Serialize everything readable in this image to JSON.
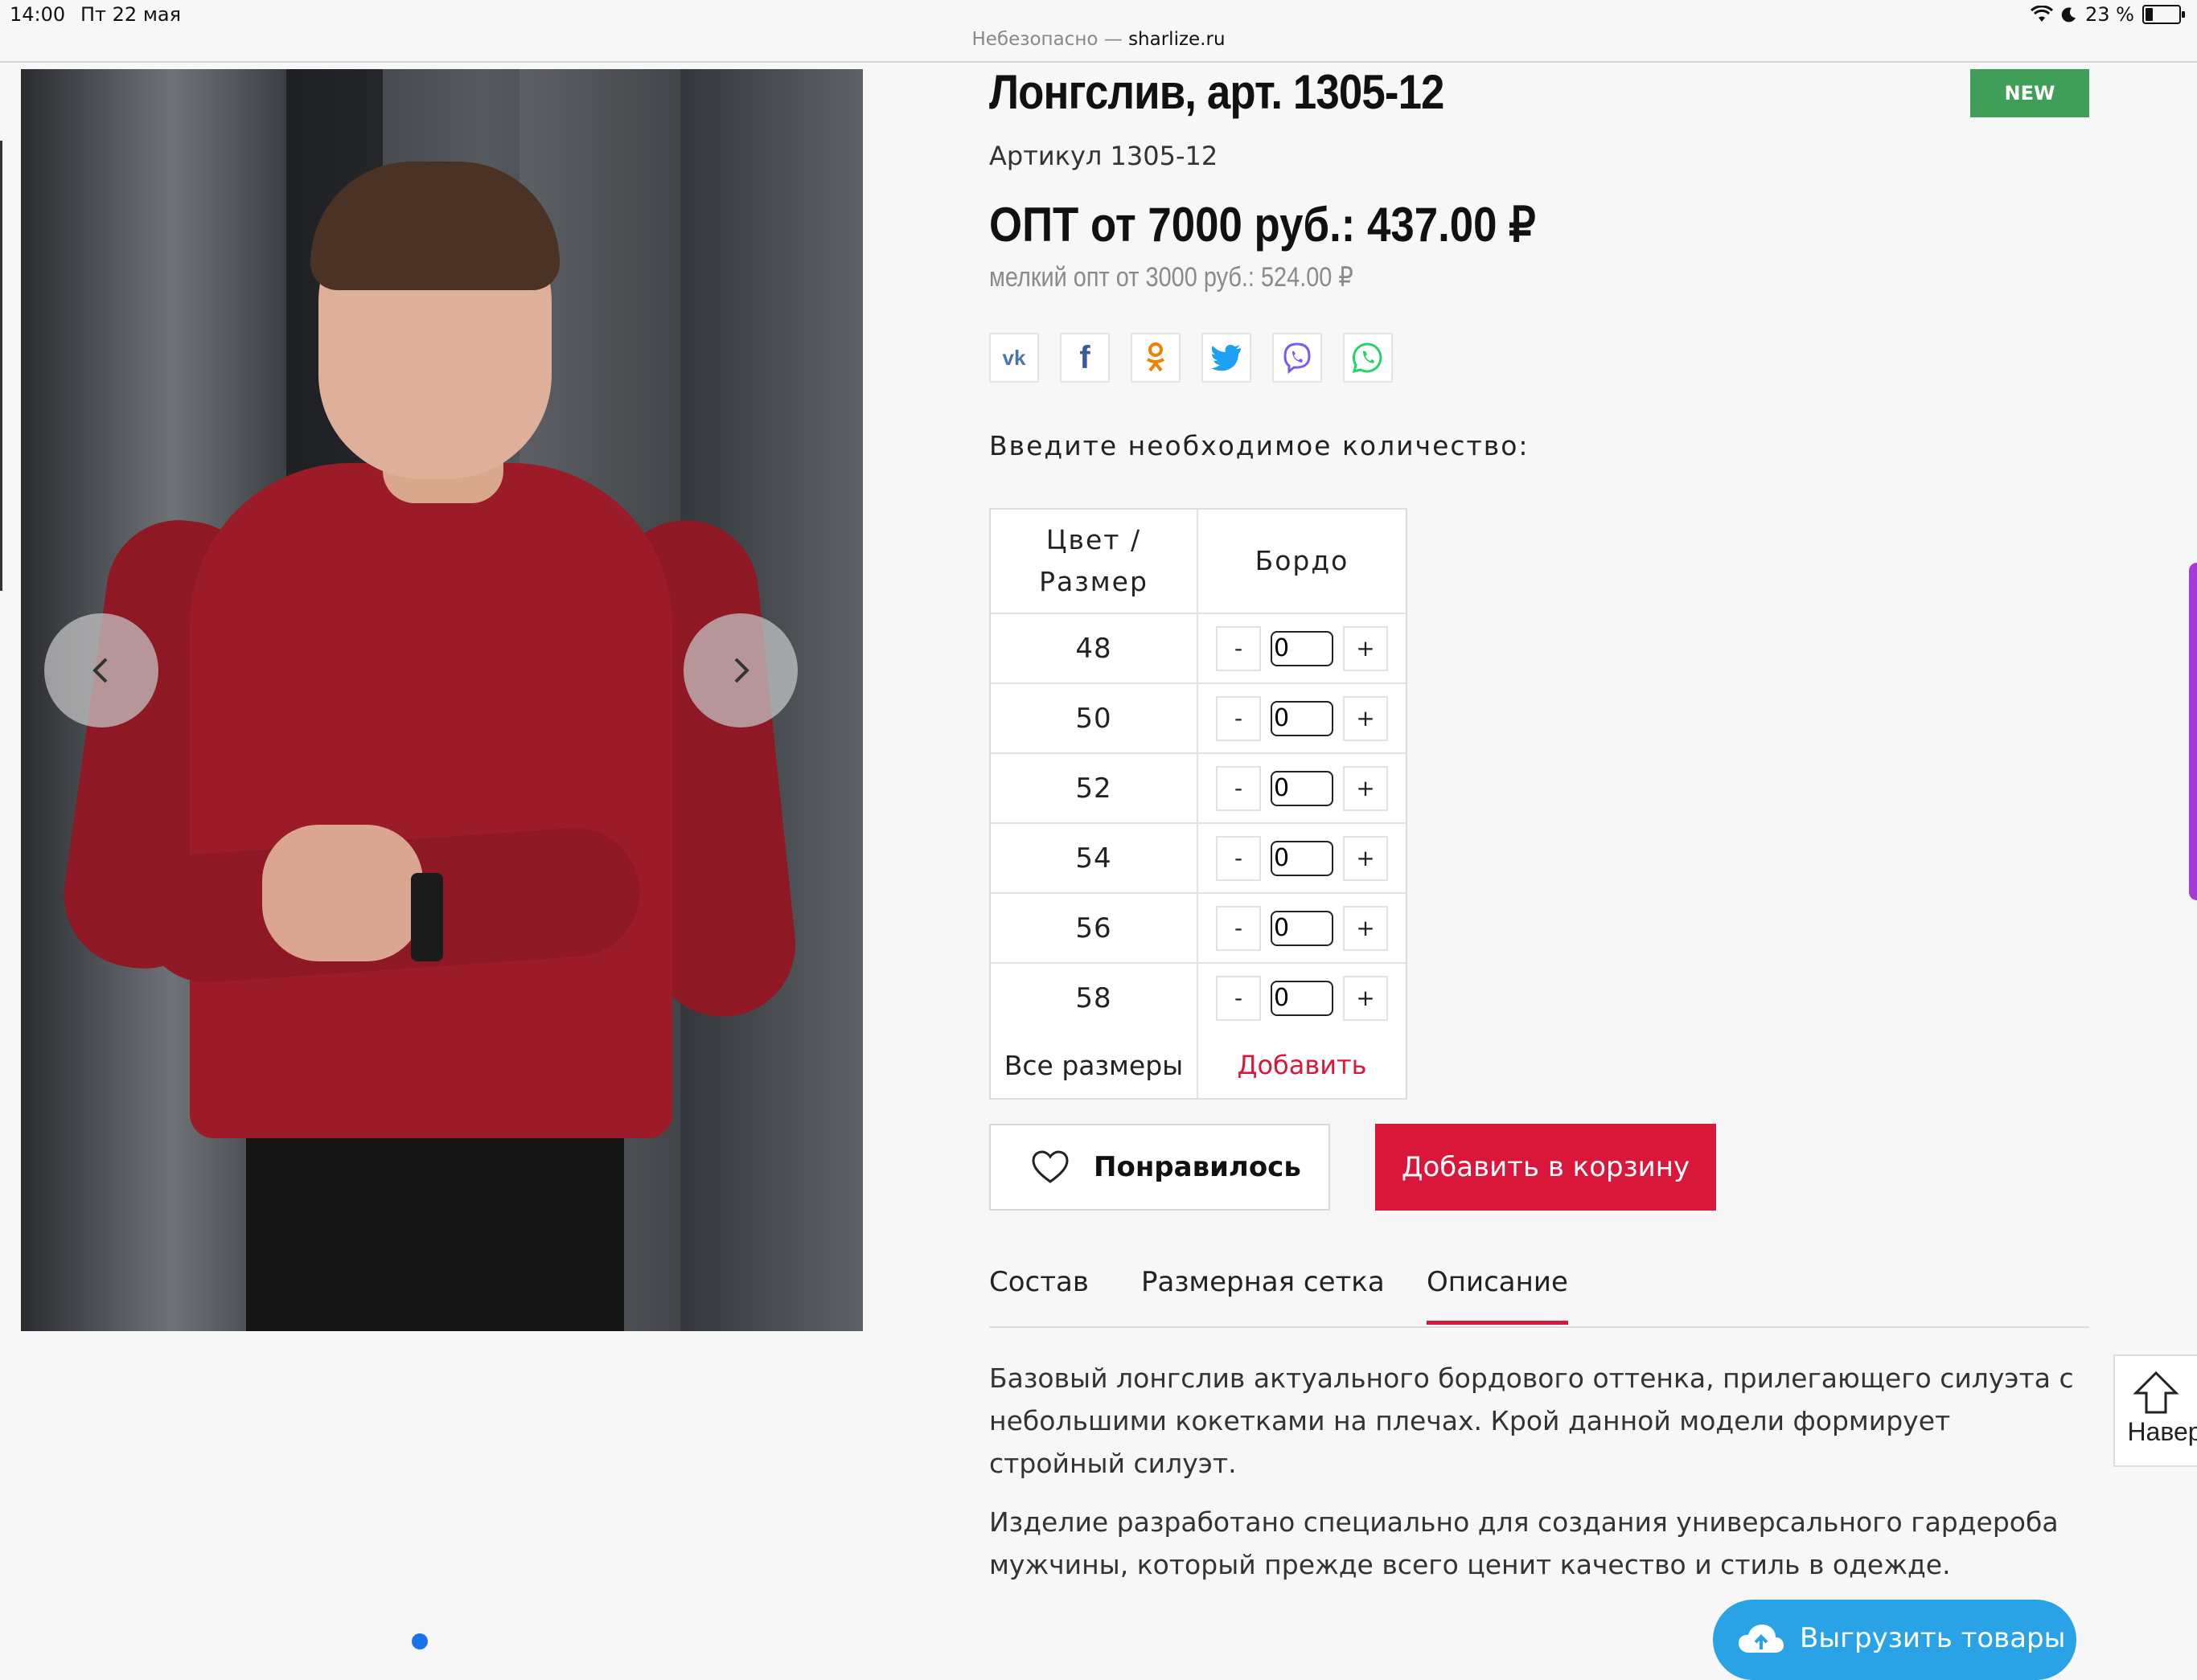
{
  "status_bar": {
    "time": "14:00",
    "date": "Пт 22 мая",
    "battery": "23 %",
    "battery_level": 0.23
  },
  "browser": {
    "security": "Небезопасно — ",
    "domain": "sharlize.ru"
  },
  "gallery": {
    "prev_icon": "chevron-left-icon",
    "next_icon": "chevron-right-icon"
  },
  "product": {
    "title": "Лонгслив, арт. 1305-12",
    "badge": "NEW",
    "sku": "Артикул 1305-12",
    "price_main": "ОПТ от 7000 руб.: 437.00 ₽",
    "price_sub": "мелкий опт от 3000 руб.: 524.00 ₽"
  },
  "social": [
    {
      "name": "vk",
      "glyph": "vk"
    },
    {
      "name": "facebook",
      "glyph": "f"
    },
    {
      "name": "odnoklassniki",
      "glyph": "ok"
    },
    {
      "name": "twitter",
      "glyph": "tw"
    },
    {
      "name": "viber",
      "glyph": "vb"
    },
    {
      "name": "whatsapp",
      "glyph": "wa"
    }
  ],
  "quantity": {
    "heading": "Введите необходимое количество:",
    "col_header": "Цвет / Размер",
    "color": "Бордо",
    "rows": [
      {
        "size": "48",
        "value": "0"
      },
      {
        "size": "50",
        "value": "0"
      },
      {
        "size": "52",
        "value": "0"
      },
      {
        "size": "54",
        "value": "0"
      },
      {
        "size": "56",
        "value": "0"
      },
      {
        "size": "58",
        "value": "0"
      }
    ],
    "minus": "-",
    "plus": "+",
    "all_sizes": "Все размеры",
    "add_link": "Добавить"
  },
  "actions": {
    "favorite": "Понравилось",
    "add_to_cart": "Добавить в корзину"
  },
  "tabs": [
    {
      "label": "Состав"
    },
    {
      "label": "Размерная сетка"
    },
    {
      "label": "Описание"
    }
  ],
  "active_tab": "Описание",
  "description": [
    "Базовый лонгслив актуального бордового оттенка, прилегающего силуэта с небольшими кокетками на плечах. Крой данной модели формирует стройный силуэт.",
    "Изделие разработано специально для создания универсального гардероба мужчины, который прежде всего ценит качество и стиль в одежде."
  ],
  "scroll_top": "Навер",
  "export_button": "Выгрузить товары",
  "colors": {
    "accent": "#d9173a",
    "badge": "#3f9e57",
    "export": "#2aa3e6"
  }
}
